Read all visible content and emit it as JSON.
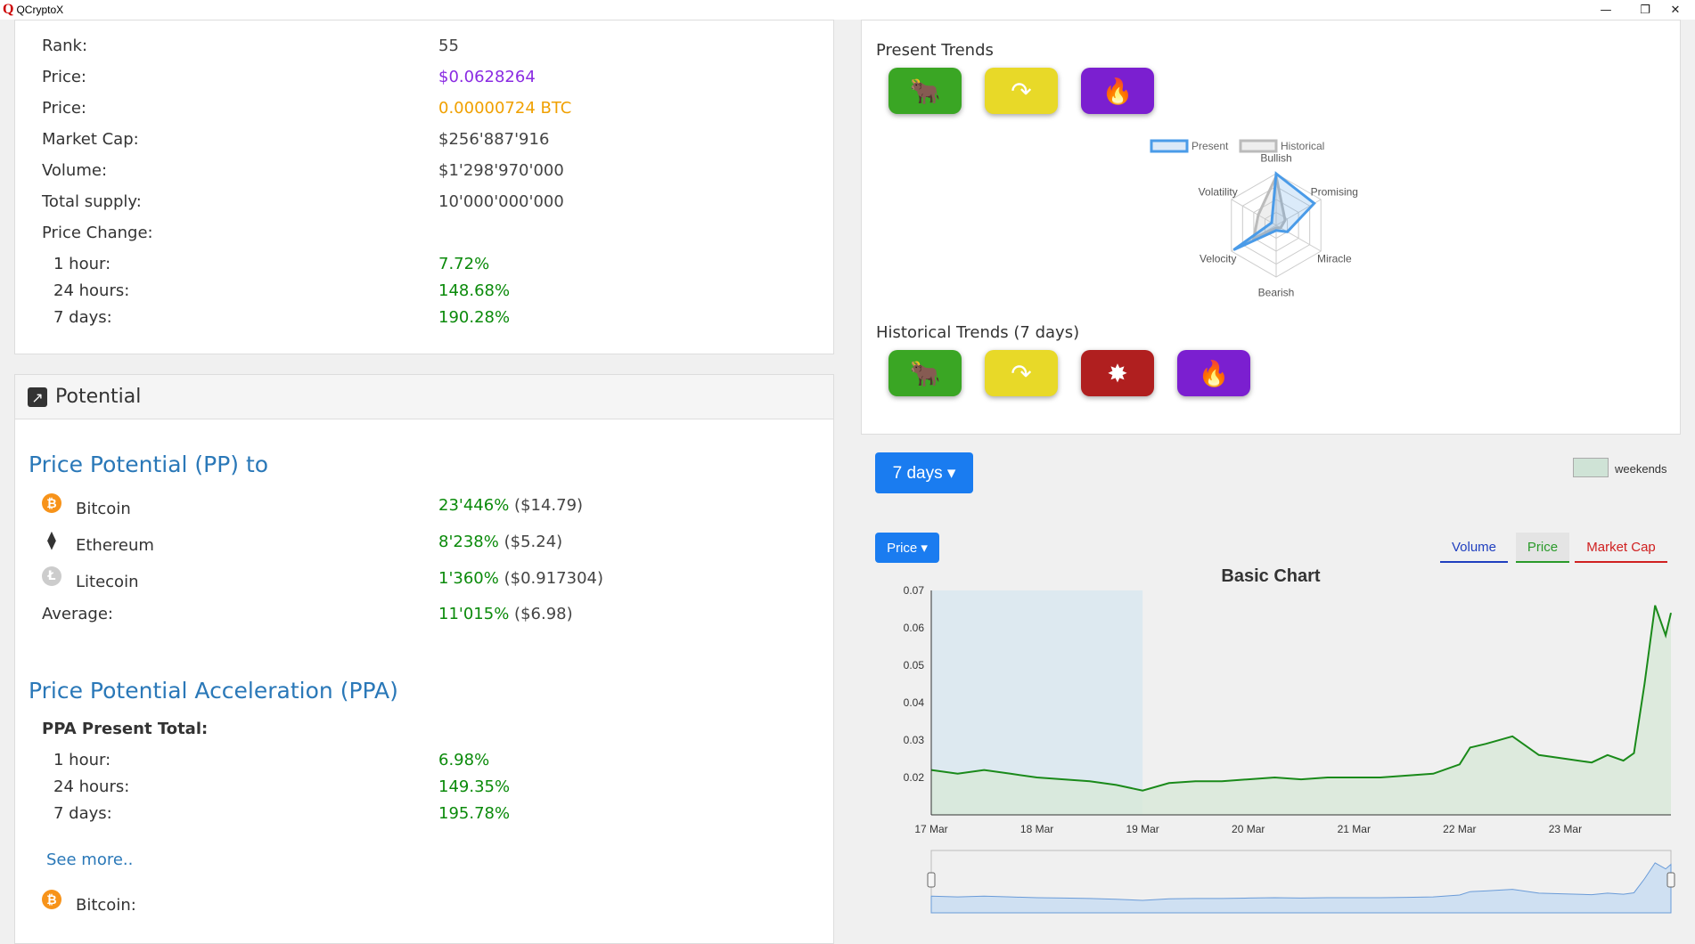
{
  "window": {
    "title": "QCryptoX",
    "minimize": "—",
    "restore": "❐",
    "close": "✕"
  },
  "info": {
    "rank_label": "Rank:",
    "rank_value": "55",
    "price_usd_label": "Price:",
    "price_usd_value": "$0.0628264",
    "price_btc_label": "Price:",
    "price_btc_value": "0.00000724 BTC",
    "market_cap_label": "Market Cap:",
    "market_cap_value": "$256'887'916",
    "volume_label": "Volume:",
    "volume_value": "$1'298'970'000",
    "supply_label": "Total supply:",
    "supply_value": "10'000'000'000",
    "price_change_label": "Price Change:",
    "hour_label": "1 hour:",
    "hour_value": "7.72%",
    "day_label": "24 hours:",
    "day_value": "148.68%",
    "week_label": "7 days:",
    "week_value": "190.28%"
  },
  "potential": {
    "panel_title": "Potential",
    "pp_heading": "Price Potential (PP) to",
    "coins": [
      {
        "name": "Bitcoin",
        "value": "23'446%",
        "usd": "($14.79)",
        "icon": "bitcoin-icon",
        "color": "#f7931a"
      },
      {
        "name": "Ethereum",
        "value": "8'238%",
        "usd": "($5.24)",
        "icon": "ethereum-icon",
        "color": "#333333"
      },
      {
        "name": "Litecoin",
        "value": "1'360%",
        "usd": "($0.917304)",
        "icon": "litecoin-icon",
        "color": "#cccccc"
      }
    ],
    "average_label": "Average:",
    "average_value": "11'015%",
    "average_usd": "($6.98)",
    "ppa_heading": "Price Potential Acceleration (PPA)",
    "ppa_total_label": "PPA Present Total:",
    "ppa_hour_label": "1 hour:",
    "ppa_hour_value": "6.98%",
    "ppa_day_label": "24 hours:",
    "ppa_day_value": "149.35%",
    "ppa_week_label": "7 days:",
    "ppa_week_value": "195.78%",
    "see_more": "See more..",
    "bitcoin_bottom_label": "Bitcoin:"
  },
  "trends": {
    "present_title": "Present Trends",
    "historical_title": "Historical Trends (7 days)",
    "present_badges": [
      {
        "icon": "bull-icon",
        "color": "#3aa624"
      },
      {
        "icon": "curved-arrow-icon",
        "color": "#e8d928"
      },
      {
        "icon": "blue-flame-icon",
        "color": "#7b1fd0"
      }
    ],
    "historical_badges": [
      {
        "icon": "bull-icon",
        "color": "#3aa624"
      },
      {
        "icon": "curved-arrow-icon",
        "color": "#e8d928"
      },
      {
        "icon": "explosion-icon",
        "color": "#b01f1f"
      },
      {
        "icon": "teal-flame-icon",
        "color": "#7b1fd0"
      }
    ],
    "radar": {
      "legend_present": "Present",
      "legend_historical": "Historical",
      "axes": [
        "Bullish",
        "Promising",
        "Miracle",
        "Bearish",
        "Velocity",
        "Volatility"
      ],
      "present": [
        1.0,
        0.85,
        0.25,
        0.1,
        0.95,
        0.1
      ],
      "historical": [
        0.95,
        0.2,
        0.1,
        0.05,
        0.5,
        0.4
      ],
      "present_color": "#4a9be8",
      "historical_color": "#bbbbbb"
    }
  },
  "chart_controls": {
    "range_button": "7 days ▾",
    "metric_button": "Price ▾",
    "weekends_label": "weekends",
    "tabs": [
      "Volume",
      "Price",
      "Market Cap"
    ],
    "tab_colors": [
      "#1f3fbf",
      "#2a9a2a",
      "#d02020"
    ]
  },
  "chart_data": {
    "type": "area",
    "title": "Basic Chart",
    "x": [
      "17 Mar",
      "17.25",
      "17.5",
      "17.75",
      "18 Mar",
      "18.25",
      "18.5",
      "18.75",
      "19 Mar",
      "19.25",
      "19.5",
      "19.75",
      "20 Mar",
      "20.25",
      "20.5",
      "20.75",
      "21 Mar",
      "21.25",
      "21.5",
      "21.75",
      "22 Mar",
      "22.25",
      "22.5",
      "22.75",
      "23 Mar",
      "23.25",
      "23.5",
      "23.75",
      "24 Mar"
    ],
    "x_tick_labels": [
      "17 Mar",
      "18 Mar",
      "19 Mar",
      "20 Mar",
      "21 Mar",
      "22 Mar",
      "23 Mar"
    ],
    "x_numeric": [
      0,
      0.25,
      0.5,
      0.75,
      1.0,
      1.25,
      1.5,
      1.75,
      2.0,
      2.25,
      2.5,
      2.75,
      3.0,
      3.25,
      3.5,
      3.75,
      4.0,
      4.25,
      4.5,
      4.75,
      5.0,
      5.1,
      5.25,
      5.5,
      5.75,
      6.0,
      6.25,
      6.4,
      6.55,
      6.65,
      6.75,
      6.85,
      6.95,
      7.0
    ],
    "values": [
      0.022,
      0.021,
      0.022,
      0.021,
      0.02,
      0.0195,
      0.019,
      0.018,
      0.0165,
      0.0185,
      0.019,
      0.019,
      0.0195,
      0.02,
      0.0195,
      0.02,
      0.02,
      0.02,
      0.0205,
      0.021,
      0.0235,
      0.028,
      0.029,
      0.031,
      0.026,
      0.025,
      0.024,
      0.026,
      0.0245,
      0.0265,
      0.045,
      0.066,
      0.058,
      0.064
    ],
    "ylim": [
      0.01,
      0.07
    ],
    "y_ticks": [
      "0.07",
      "0.06",
      "0.05",
      "0.04",
      "0.03",
      "0.02"
    ],
    "weekend_range": [
      0,
      2
    ],
    "line_color": "#1a8a1a",
    "fill_color": "#d8e8d8",
    "weekend_color": "#dde9f0"
  }
}
